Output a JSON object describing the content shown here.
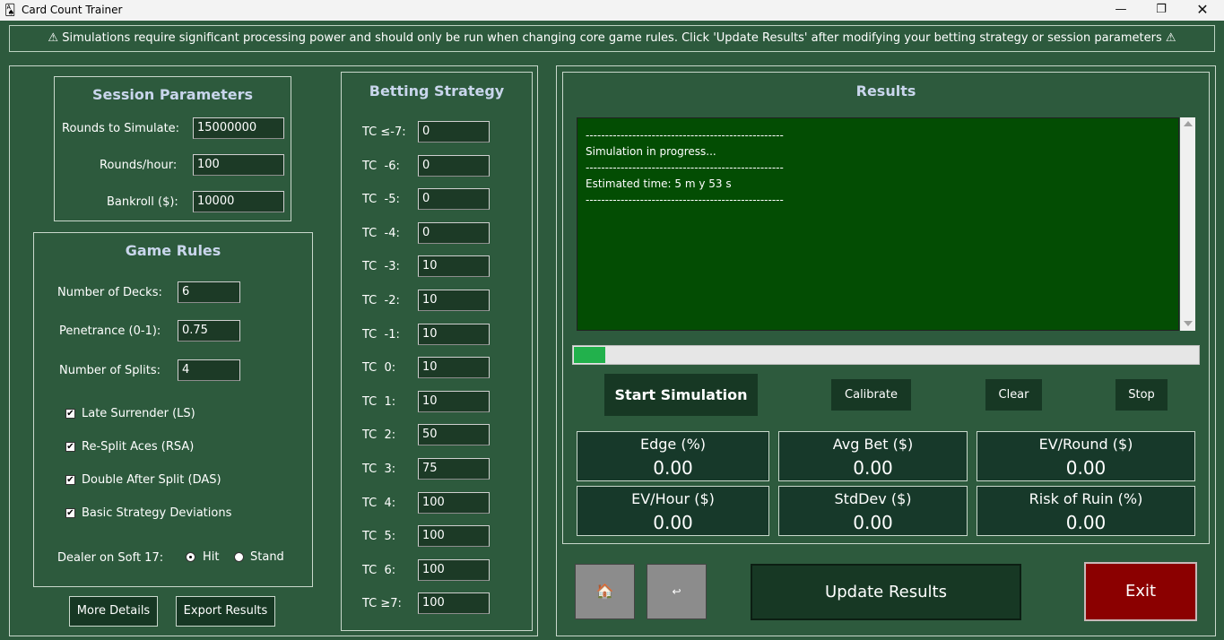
{
  "window": {
    "title": "Card Count Trainer",
    "icon": "app-icon",
    "controls": [
      "minimize",
      "maximize",
      "close"
    ]
  },
  "banner": {
    "text": "Simulations require significant processing power and should only be run when changing core game rules. Click 'Update Results' after modifying your betting strategy or session parameters",
    "icon": "⚠"
  },
  "session": {
    "title": "Session Parameters",
    "rounds_label": "Rounds to Simulate:",
    "rounds_value": "15000000",
    "rph_label": "Rounds/hour:",
    "rph_value": "100",
    "bankroll_label": "Bankroll ($):",
    "bankroll_value": "10000"
  },
  "rules": {
    "title": "Game Rules",
    "decks_label": "Number of Decks:",
    "decks_value": "6",
    "pen_label": "Penetrance (0-1):",
    "pen_value": "0.75",
    "splits_label": "Number of Splits:",
    "splits_value": "4",
    "checks": [
      {
        "label": "Late Surrender (LS)",
        "checked": true
      },
      {
        "label": "Re-Split Aces (RSA)",
        "checked": true
      },
      {
        "label": "Double After Split (DAS)",
        "checked": true
      },
      {
        "label": "Basic Strategy Deviations",
        "checked": true
      }
    ],
    "soft17_label": "Dealer on Soft 17:",
    "soft17_options": [
      "Hit",
      "Stand"
    ],
    "soft17_selected": "Hit"
  },
  "buttons": {
    "more_details": "More Details",
    "export": "Export Results",
    "start": "Start Simulation",
    "calibrate": "Calibrate",
    "clear": "Clear",
    "stop": "Stop",
    "update": "Update Results",
    "exit": "Exit",
    "home_icon": "🏠",
    "back_icon": "↩"
  },
  "betting": {
    "title": "Betting Strategy",
    "rows": [
      {
        "label": "TC ≤-7:",
        "value": "0"
      },
      {
        "label": "TC  -6:",
        "value": "0"
      },
      {
        "label": "TC  -5:",
        "value": "0"
      },
      {
        "label": "TC  -4:",
        "value": "0"
      },
      {
        "label": "TC  -3:",
        "value": "10"
      },
      {
        "label": "TC  -2:",
        "value": "10"
      },
      {
        "label": "TC  -1:",
        "value": "10"
      },
      {
        "label": "TC  0:",
        "value": "10"
      },
      {
        "label": "TC  1:",
        "value": "10"
      },
      {
        "label": "TC  2:",
        "value": "50"
      },
      {
        "label": "TC  3:",
        "value": "75"
      },
      {
        "label": "TC  4:",
        "value": "100"
      },
      {
        "label": "TC  5:",
        "value": "100"
      },
      {
        "label": "TC  6:",
        "value": "100"
      },
      {
        "label": "TC ≥7:",
        "value": "100"
      }
    ]
  },
  "results": {
    "title": "Results",
    "lines": [
      "---------------------------------------------------",
      "Simulation in progress...",
      "---------------------------------------------------",
      "Estimated time: 5 m y 53 s",
      "---------------------------------------------------"
    ],
    "progress": 0.05,
    "stats": [
      {
        "title": "Edge (%)",
        "value": "0.00"
      },
      {
        "title": "Avg Bet ($)",
        "value": "0.00"
      },
      {
        "title": "EV/Round ($)",
        "value": "0.00"
      },
      {
        "title": "EV/Hour ($)",
        "value": "0.00"
      },
      {
        "title": "StdDev ($)",
        "value": "0.00"
      },
      {
        "title": "Risk of Ruin (%)",
        "value": "0.00"
      }
    ]
  },
  "colors": {
    "background": "#2d5a3d",
    "dark_button": "#173824",
    "exit_button": "#8b0000",
    "progress": "#22b14c",
    "results_bg": "#034d03"
  }
}
